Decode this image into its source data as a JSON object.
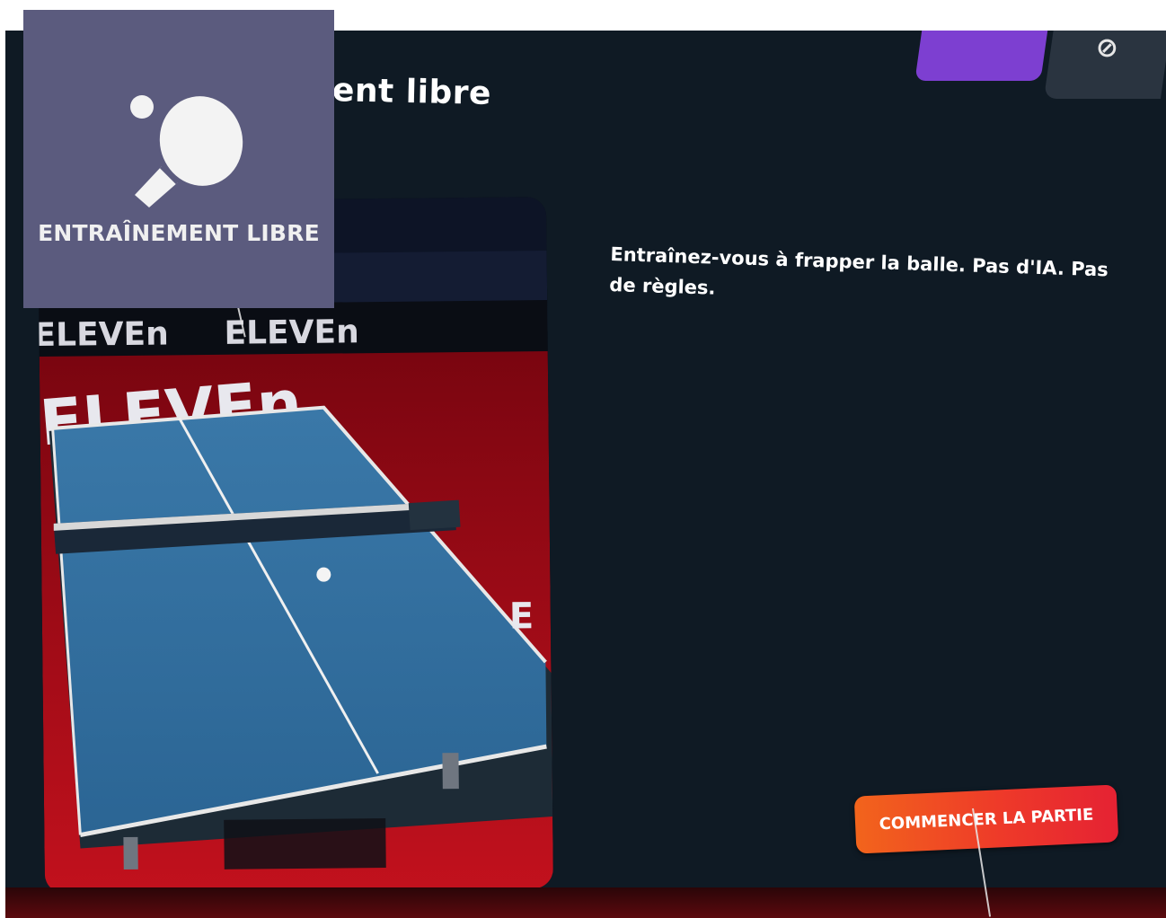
{
  "screen": {
    "title": "Entraînement libre",
    "title_visible_fragment": "ent libre",
    "top_buttons": {
      "settings_icon": "slash-circle-icon",
      "settings_glyph": "⊘"
    }
  },
  "mode_tile": {
    "label": "ENTRAÎNEMENT LIBRE",
    "icon": "ping-pong-paddle-icon"
  },
  "description": "Entraînez-vous à frapper la balle. Pas d'IA. Pas de règles.",
  "preview": {
    "brand_text": "ELEVEn",
    "banner_left": "ELEVEn",
    "banner_right": "ELEVEn"
  },
  "actions": {
    "start_label": "COMMENCER LA PARTIE"
  },
  "colors": {
    "panel_bg": "#0f1a24",
    "tile_bg": "#5b5b7e",
    "accent_orange": "#f2641c",
    "accent_red": "#e52233",
    "table_blue": "#2f6fa0",
    "floor_red": "#b00c18",
    "purple_button": "#7d3fd1"
  }
}
